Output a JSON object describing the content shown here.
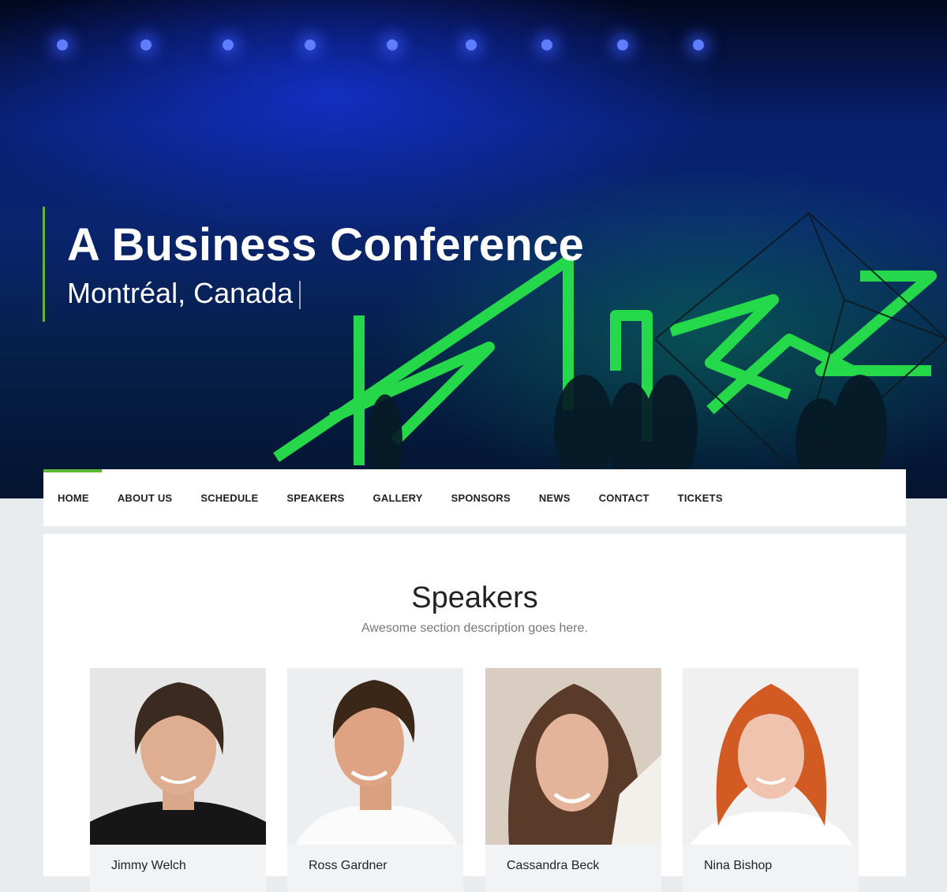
{
  "hero": {
    "title": "A Business Conference",
    "subtitle": "Montréal, Canada",
    "accent_color": "#5cb836"
  },
  "nav": {
    "items": [
      "HOME",
      "ABOUT US",
      "SCHEDULE",
      "SPEAKERS",
      "GALLERY",
      "SPONSORS",
      "NEWS",
      "CONTACT",
      "TICKETS"
    ],
    "active": "HOME"
  },
  "speakers": {
    "title": "Speakers",
    "description": "Awesome section description goes here.",
    "people": [
      {
        "name": "Jimmy Welch"
      },
      {
        "name": "Ross Gardner"
      },
      {
        "name": "Cassandra Beck"
      },
      {
        "name": "Nina Bishop"
      }
    ]
  }
}
